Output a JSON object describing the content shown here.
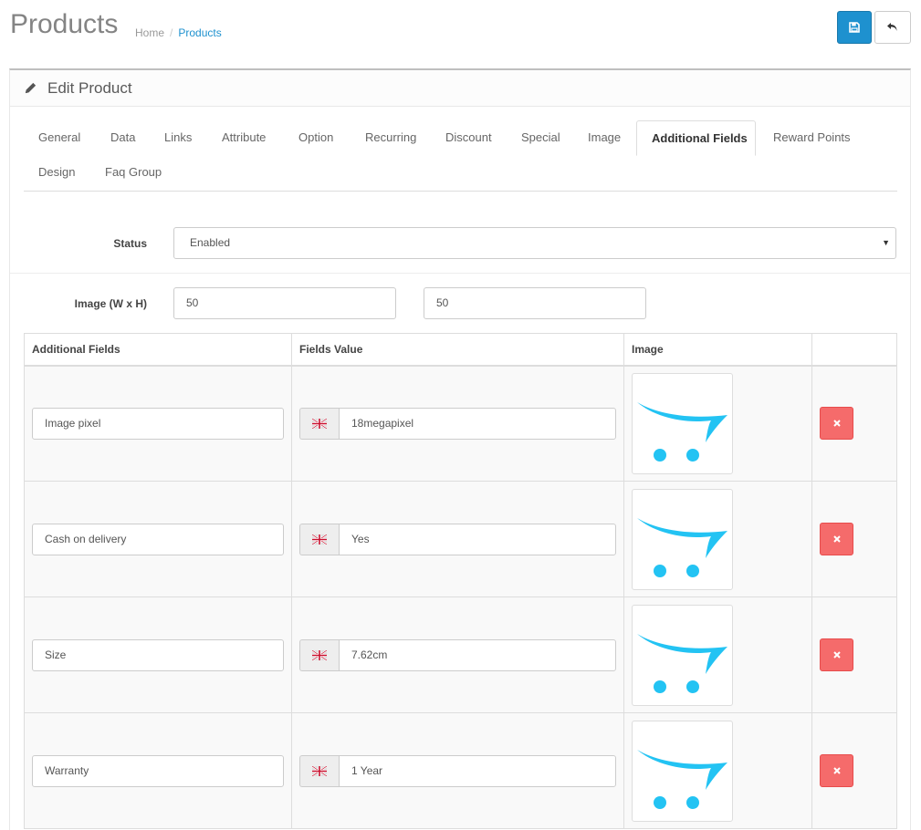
{
  "header": {
    "title": "Products",
    "breadcrumb": [
      "Home",
      "Products"
    ],
    "save_icon": "save-icon",
    "back_icon": "reply-icon",
    "primary_color": "#1e91cf"
  },
  "panel": {
    "title": "Edit Product",
    "icon": "pencil-icon"
  },
  "tabs": [
    {
      "label": "General",
      "active": false
    },
    {
      "label": "Data",
      "active": false
    },
    {
      "label": "Links",
      "active": false
    },
    {
      "label": "Attribute",
      "active": false
    },
    {
      "label": "Option",
      "active": false
    },
    {
      "label": "Recurring",
      "active": false
    },
    {
      "label": "Discount",
      "active": false
    },
    {
      "label": "Special",
      "active": false
    },
    {
      "label": "Image",
      "active": false
    },
    {
      "label": "Additional Fields",
      "active": true
    },
    {
      "label": "Reward Points",
      "active": false
    },
    {
      "label": "Design",
      "active": false
    },
    {
      "label": "Faq Group",
      "active": false
    }
  ],
  "form": {
    "status_label": "Status",
    "status_value": "Enabled",
    "image_size_label": "Image (W x H)",
    "image_width": "50",
    "image_height": "50"
  },
  "table": {
    "headers": [
      "Additional Fields",
      "Fields Value",
      "Image",
      ""
    ],
    "rows": [
      {
        "field": "Image pixel",
        "value": "18megapixel"
      },
      {
        "field": "Cash on delivery",
        "value": "Yes"
      },
      {
        "field": "Size",
        "value": "7.62cm"
      },
      {
        "field": "Warranty",
        "value": "1 Year"
      }
    ],
    "language_icon": "uk-flag-icon",
    "thumb_icon": "opencart-cart-icon",
    "remove_icon": "close-icon",
    "remove_color": "#f56b6b"
  }
}
